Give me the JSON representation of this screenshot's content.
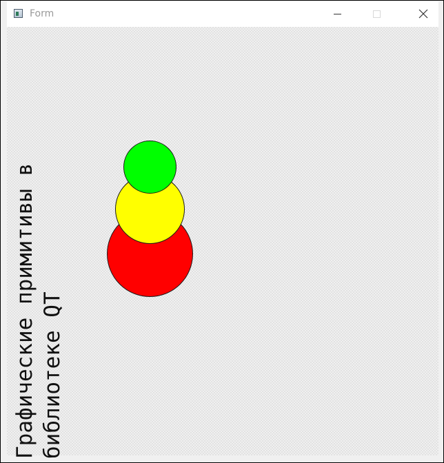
{
  "window": {
    "title": "Form"
  },
  "controls": {
    "minimize_icon": "minimize-icon",
    "maximize_icon": "maximize-icon",
    "close_icon": "close-icon"
  },
  "content": {
    "text_line1": "Графические примитивы в",
    "text_line2": "библиотеке QT"
  },
  "circles": [
    {
      "color": "#ff0000",
      "label": "red"
    },
    {
      "color": "#ffff00",
      "label": "yellow"
    },
    {
      "color": "#00ff00",
      "label": "green"
    }
  ]
}
